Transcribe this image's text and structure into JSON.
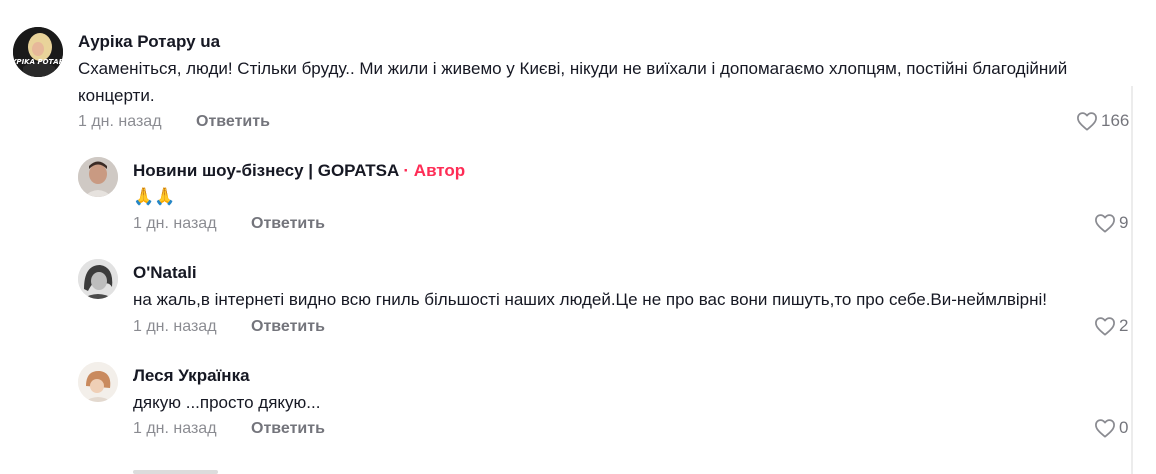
{
  "comments": [
    {
      "author": "Аурiка Ротару ua",
      "avatar_caption": "AYPIKA РОТАРУ",
      "text": "Схаменіться, люди! Стільки бруду.. Ми жили і живемо у Києві, нікуди не виїхали і допомагаємо хлопцям, постійні благодійний концерти.",
      "time": "1 дн. назад",
      "reply_label": "Ответить",
      "likes": "166"
    }
  ],
  "replies": [
    {
      "author": "Новини шоу-бізнесу | GOPATSA",
      "separator": "·",
      "badge": "Автор",
      "text": "🙏🙏",
      "time": "1 дн. назад",
      "reply_label": "Ответить",
      "likes": "9"
    },
    {
      "author": "O'Natali",
      "text": "на жаль,в інтернеті видно всю гниль більшості наших людей.Це не про вас вони пишуть,то про себе.Ви-неймлвірні!",
      "time": "1 дн. назад",
      "reply_label": "Ответить",
      "likes": "2"
    },
    {
      "author": "Леся Українка",
      "text": "дякую ...просто дякую...",
      "time": "1 дн. назад",
      "reply_label": "Ответить",
      "likes": "0"
    }
  ],
  "icons": {
    "like": "heart-outline-icon"
  },
  "colors": {
    "author_badge": "#fe2c55",
    "text": "#161823",
    "muted": "#8a8b91"
  }
}
